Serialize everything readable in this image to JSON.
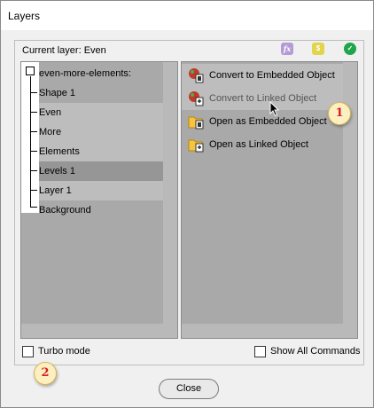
{
  "window": {
    "title": "Layers"
  },
  "header": {
    "current_layer": "Current layer: Even"
  },
  "toolbar_icons": [
    {
      "name": "fx-icon",
      "glyph": "fx",
      "color": "#b59bd6"
    },
    {
      "name": "dollar-icon",
      "glyph": "$",
      "color": "#e2d44c"
    },
    {
      "name": "check-icon",
      "glyph": "✓",
      "color": "#1fa54a"
    }
  ],
  "tree": {
    "root": "even-more-elements:",
    "items": [
      {
        "label": "Shape 1"
      },
      {
        "label": "Even"
      },
      {
        "label": "More"
      },
      {
        "label": "Elements"
      },
      {
        "label": "Levels 1"
      },
      {
        "label": "Layer 1"
      },
      {
        "label": "Background"
      }
    ]
  },
  "commands": [
    {
      "label": "Convert to Embedded Object"
    },
    {
      "label": "Convert to Linked Object"
    },
    {
      "label": "Open as Embedded Object"
    },
    {
      "label": "Open as Linked Object"
    }
  ],
  "options": {
    "turbo_mode": "Turbo mode",
    "show_all_commands": "Show All Commands"
  },
  "badges": {
    "one": "1",
    "two": "2"
  },
  "footer": {
    "close_label": "Close"
  }
}
